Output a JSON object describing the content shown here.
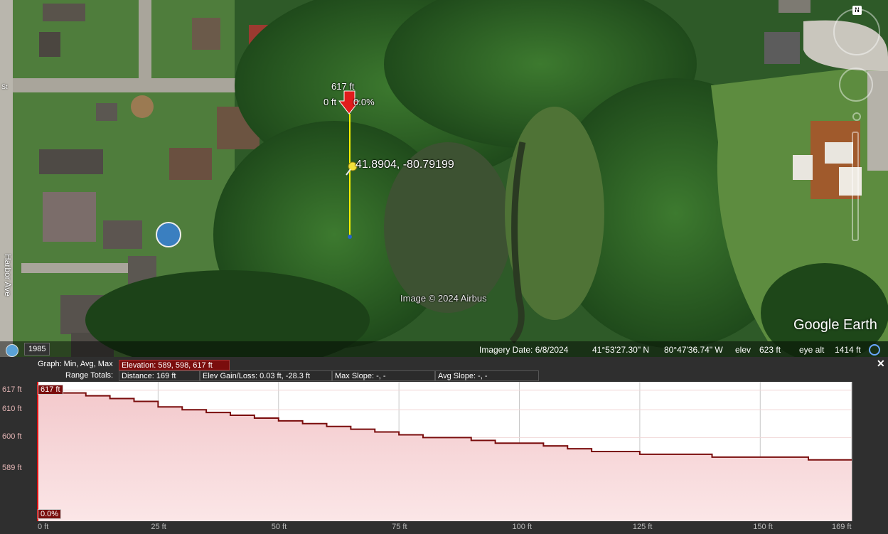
{
  "map": {
    "path_label": "41.8904, -80.79199",
    "path_elevation_label": "617 ft",
    "path_distance_label": "0 ft",
    "path_slope_label": "0.0%",
    "copyright": "Image © 2024 Airbus",
    "logo": "Google Earth",
    "street_name": "Harbor Ave",
    "street_fragment": "St",
    "north_indicator": "N",
    "pin_icon": "yellow-pushpin-icon",
    "cursor_icon": "red-arrow-marker-icon"
  },
  "status_bar": {
    "imagery_date": "Imagery Date: 6/8/2024",
    "lat": "41°53'27.30\" N",
    "lon": "80°47'36.74\" W",
    "elev_label": "elev",
    "elev_value": "623 ft",
    "eye_alt_label": "eye alt",
    "eye_alt_value": "1414 ft",
    "historical_year": "1985"
  },
  "profile_panel": {
    "graph_label": "Graph: Min, Avg, Max",
    "elevation_summary": "Elevation: 589, 598, 617 ft",
    "range_totals_label": "Range Totals:",
    "distance": "Distance: 169 ft",
    "elev_gain_loss": "Elev Gain/Loss: 0.03 ft, -28.3 ft",
    "max_slope": "Max Slope: -, -",
    "avg_slope": "Avg Slope: -, -",
    "close": "✕",
    "y_ticks": [
      "617 ft",
      "610 ft",
      "600 ft",
      "589 ft"
    ],
    "x_ticks": [
      "0 ft",
      "25 ft",
      "50 ft",
      "75 ft",
      "100 ft",
      "125 ft",
      "150 ft",
      "169 ft"
    ],
    "cursor_elevation_tag": "617 ft",
    "cursor_slope_tag": "0.0%",
    "colors": {
      "fill_top": "#f3c9cc",
      "fill_bottom": "#fbe6e7",
      "line": "#7a0d0d"
    }
  },
  "chart_data": {
    "type": "area",
    "title": "",
    "xlabel": "",
    "ylabel": "",
    "xlim": [
      0,
      169
    ],
    "ylim": [
      589,
      617
    ],
    "x": [
      0,
      5,
      10,
      15,
      20,
      25,
      30,
      35,
      40,
      45,
      50,
      55,
      60,
      65,
      70,
      75,
      80,
      85,
      90,
      95,
      100,
      105,
      110,
      115,
      120,
      125,
      130,
      135,
      140,
      145,
      150,
      155,
      160,
      165,
      169
    ],
    "series": [
      {
        "values": [
          617,
          616,
          615,
          614,
          613,
          611,
          610,
          609,
          608,
          607,
          606,
          605,
          604,
          603,
          602,
          601,
          600,
          600,
          599,
          598,
          598,
          597,
          596,
          595,
          595,
          594,
          594,
          594,
          593,
          593,
          593,
          593,
          592,
          592,
          592
        ]
      }
    ]
  }
}
